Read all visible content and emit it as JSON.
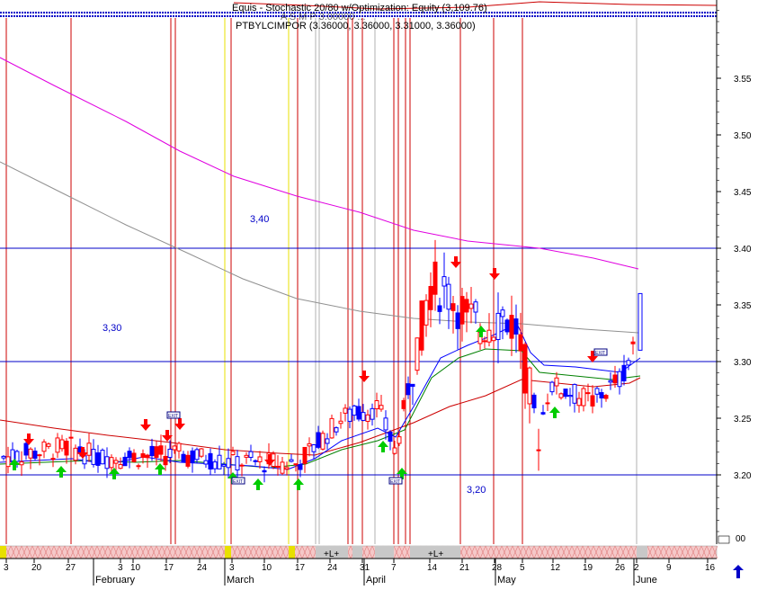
{
  "header": {
    "line1": "Equis - Stochastic 20/80 w/Optimization: Equity (3,109.76)",
    "line2": "PTBYLCIMPOR (3.36000, 3.36000, 3.31000, 3.36000)",
    "line3": "A S M P 3.00000 ..."
  },
  "chart_data": {
    "type": "candlestick",
    "y_axis": {
      "range": [
        3.15,
        3.61
      ],
      "ticks": [
        "3.55",
        "3.50",
        "3.45",
        "3.40",
        "3.35",
        "3.30",
        "3.25",
        "3.20"
      ],
      "bottom_label": "00"
    },
    "x_axis": {
      "day_ticks": [
        "3",
        "20",
        "27",
        "3",
        "10",
        "17",
        "24",
        "3",
        "10",
        "17",
        "24",
        "31",
        "7",
        "14",
        "21",
        "28",
        "5",
        "12",
        "19",
        "26",
        "2",
        "9",
        "16"
      ],
      "months": [
        "February",
        "March",
        "April",
        "May",
        "June"
      ]
    },
    "levels": [
      {
        "price": 3.4,
        "label": "3,40"
      },
      {
        "price": 3.3,
        "label": "3,30"
      },
      {
        "price": 3.2,
        "label": "3,20"
      }
    ],
    "trades": {
      "entry_label": "+L+",
      "exit_label": "EXIT"
    },
    "last_bar": {
      "open": 3.36,
      "high": 3.36,
      "low": 3.31,
      "close": 3.36
    },
    "colors": {
      "up": "#0000ff",
      "down": "#ff0000",
      "ma_long": "#e000e0",
      "ma_mid": "#909090",
      "ma_short": "#008000",
      "ma_red": "#cc0000",
      "level_line": "#0000c8",
      "buy_arrow": "#00cc00",
      "sell_arrow": "#ff0000"
    }
  }
}
